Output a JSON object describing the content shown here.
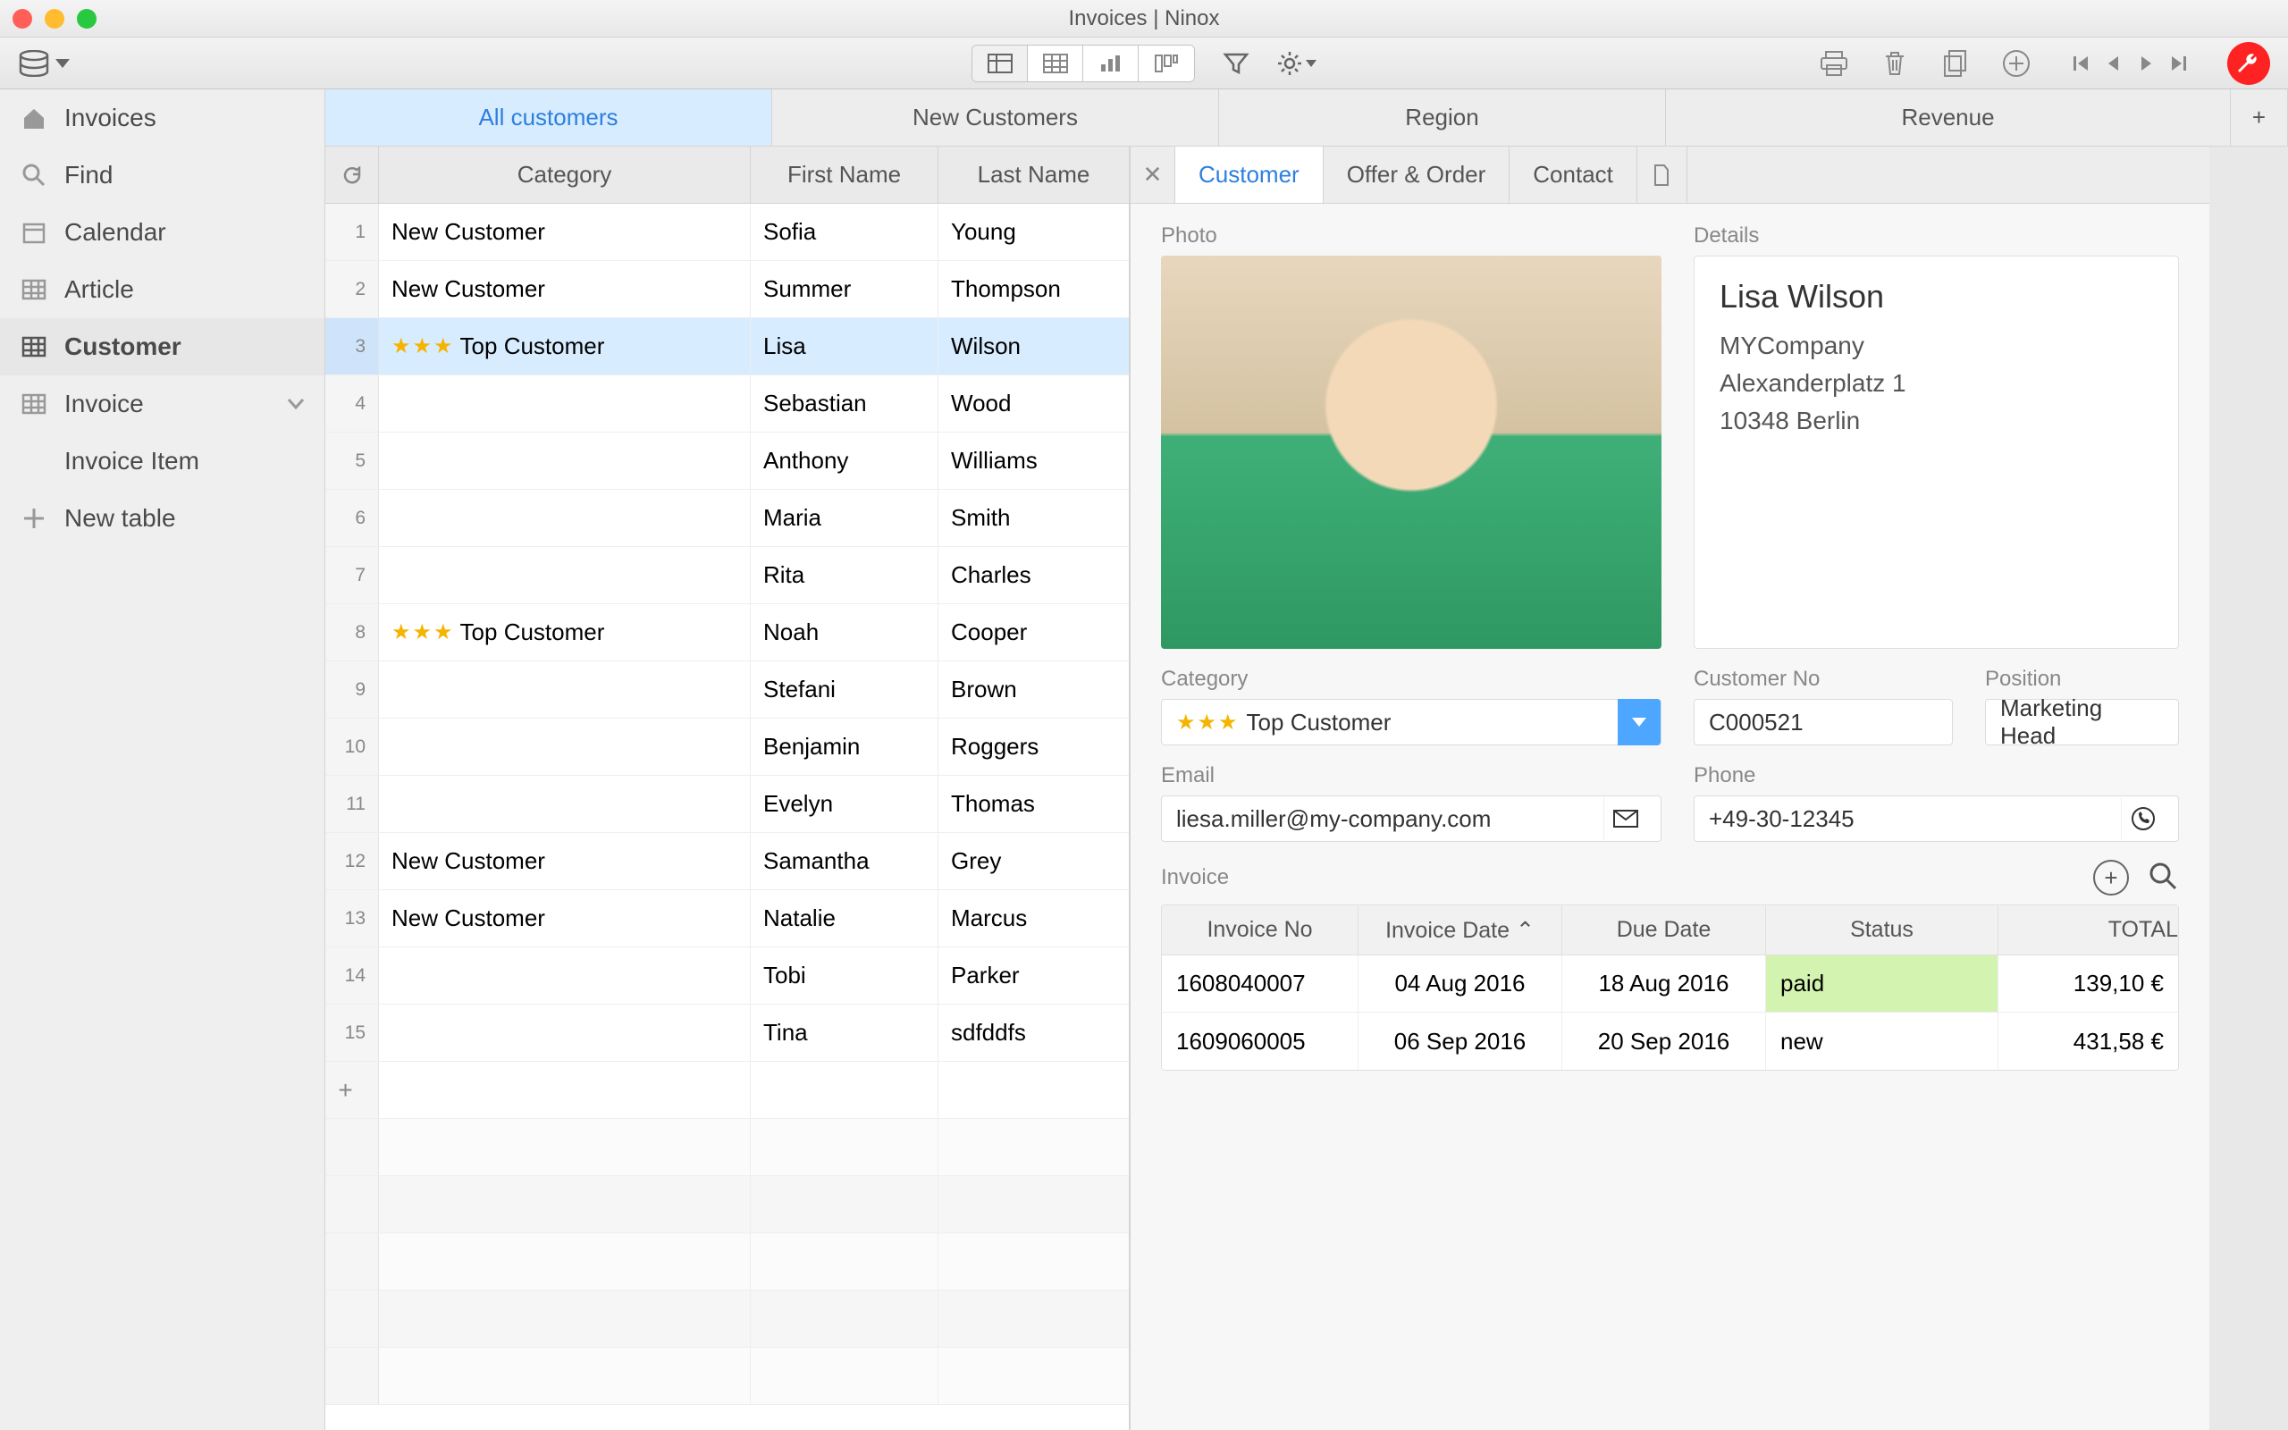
{
  "window": {
    "title": "Invoices | Ninox"
  },
  "sidebar": {
    "items": [
      {
        "label": "Invoices"
      },
      {
        "label": "Find"
      },
      {
        "label": "Calendar"
      },
      {
        "label": "Article"
      },
      {
        "label": "Customer"
      },
      {
        "label": "Invoice"
      },
      {
        "label": "Invoice Item"
      },
      {
        "label": "New table"
      }
    ]
  },
  "viewTabs": {
    "items": [
      {
        "label": "All customers"
      },
      {
        "label": "New Customers"
      },
      {
        "label": "Region"
      },
      {
        "label": "Revenue"
      }
    ]
  },
  "table": {
    "columns": {
      "category": "Category",
      "firstName": "First Name",
      "lastName": "Last Name"
    },
    "rows": [
      {
        "n": "1",
        "category": "New Customer",
        "stars": 0,
        "first": "Sofia",
        "last": "Young"
      },
      {
        "n": "2",
        "category": "New Customer",
        "stars": 0,
        "first": "Summer",
        "last": "Thompson"
      },
      {
        "n": "3",
        "category": "Top Customer",
        "stars": 3,
        "first": "Lisa",
        "last": "Wilson"
      },
      {
        "n": "4",
        "category": "",
        "stars": 0,
        "first": "Sebastian",
        "last": "Wood"
      },
      {
        "n": "5",
        "category": "",
        "stars": 0,
        "first": "Anthony",
        "last": "Williams"
      },
      {
        "n": "6",
        "category": "",
        "stars": 0,
        "first": "Maria",
        "last": "Smith"
      },
      {
        "n": "7",
        "category": "",
        "stars": 0,
        "first": "Rita",
        "last": "Charles"
      },
      {
        "n": "8",
        "category": "Top Customer",
        "stars": 3,
        "first": "Noah",
        "last": "Cooper"
      },
      {
        "n": "9",
        "category": "",
        "stars": 0,
        "first": "Stefani",
        "last": "Brown"
      },
      {
        "n": "10",
        "category": "",
        "stars": 0,
        "first": "Benjamin",
        "last": "Roggers"
      },
      {
        "n": "11",
        "category": "",
        "stars": 0,
        "first": "Evelyn",
        "last": "Thomas"
      },
      {
        "n": "12",
        "category": "New Customer",
        "stars": 0,
        "first": "Samantha",
        "last": "Grey"
      },
      {
        "n": "13",
        "category": "New Customer",
        "stars": 0,
        "first": "Natalie",
        "last": "Marcus"
      },
      {
        "n": "14",
        "category": "",
        "stars": 0,
        "first": "Tobi",
        "last": "Parker"
      },
      {
        "n": "15",
        "category": "",
        "stars": 0,
        "first": "Tina",
        "last": "sdfddfs"
      }
    ]
  },
  "detail": {
    "tabs": [
      {
        "label": "Customer"
      },
      {
        "label": "Offer & Order"
      },
      {
        "label": "Contact"
      }
    ],
    "photoLabel": "Photo",
    "detailsLabel": "Details",
    "name": "Lisa Wilson",
    "company": "MYCompany",
    "street": "Alexanderplatz 1",
    "city": "10348 Berlin",
    "categoryLabel": "Category",
    "categoryValue": "Top Customer",
    "customerNoLabel": "Customer No",
    "customerNo": "C000521",
    "positionLabel": "Position",
    "position": "Marketing Head",
    "emailLabel": "Email",
    "email": "liesa.miller@my-company.com",
    "phoneLabel": "Phone",
    "phone": "+49-30-12345",
    "invoiceLabel": "Invoice",
    "invoiceCols": {
      "no": "Invoice No",
      "date": "Invoice Date ⌃",
      "due": "Due Date",
      "status": "Status",
      "total": "TOTAL"
    },
    "invoices": [
      {
        "no": "1608040007",
        "date": "04 Aug 2016",
        "due": "18 Aug 2016",
        "status": "paid",
        "total": "139,10 €"
      },
      {
        "no": "1609060005",
        "date": "06 Sep 2016",
        "due": "20 Sep 2016",
        "status": "new",
        "total": "431,58 €"
      }
    ]
  }
}
